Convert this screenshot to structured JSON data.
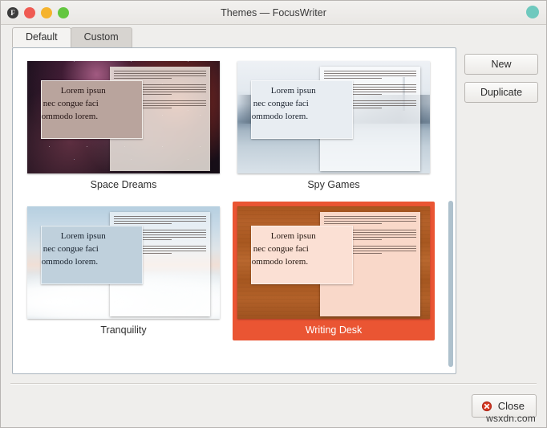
{
  "window": {
    "title": "Themes — FocusWriter",
    "app_badge": "F",
    "controls": {
      "close": "close-button",
      "minimize": "minimize-button",
      "maximize": "maximize-button"
    },
    "accent_color": "#ea5533",
    "titlebar_right_dot_color": "#6fc9be"
  },
  "tabs": [
    {
      "label": "Default",
      "active": true
    },
    {
      "label": "Custom",
      "active": false
    }
  ],
  "themes": [
    {
      "name": "Space Dreams",
      "selected": false,
      "preview_lines": [
        "Lorem ipsun",
        "nec congue faci",
        "ommodo lorem."
      ]
    },
    {
      "name": "Spy Games",
      "selected": false,
      "preview_lines": [
        "Lorem ipsun",
        "nec congue faci",
        "ommodo lorem."
      ]
    },
    {
      "name": "Tranquility",
      "selected": false,
      "preview_lines": [
        "Lorem ipsun",
        "nec congue faci",
        "ommodo lorem."
      ]
    },
    {
      "name": "Writing Desk",
      "selected": true,
      "preview_lines": [
        "Lorem ipsun",
        "nec congue faci",
        "ommodo lorem."
      ]
    }
  ],
  "side_buttons": {
    "new": "New",
    "duplicate": "Duplicate"
  },
  "footer": {
    "close": "Close"
  },
  "watermark": "wsxdn.com"
}
